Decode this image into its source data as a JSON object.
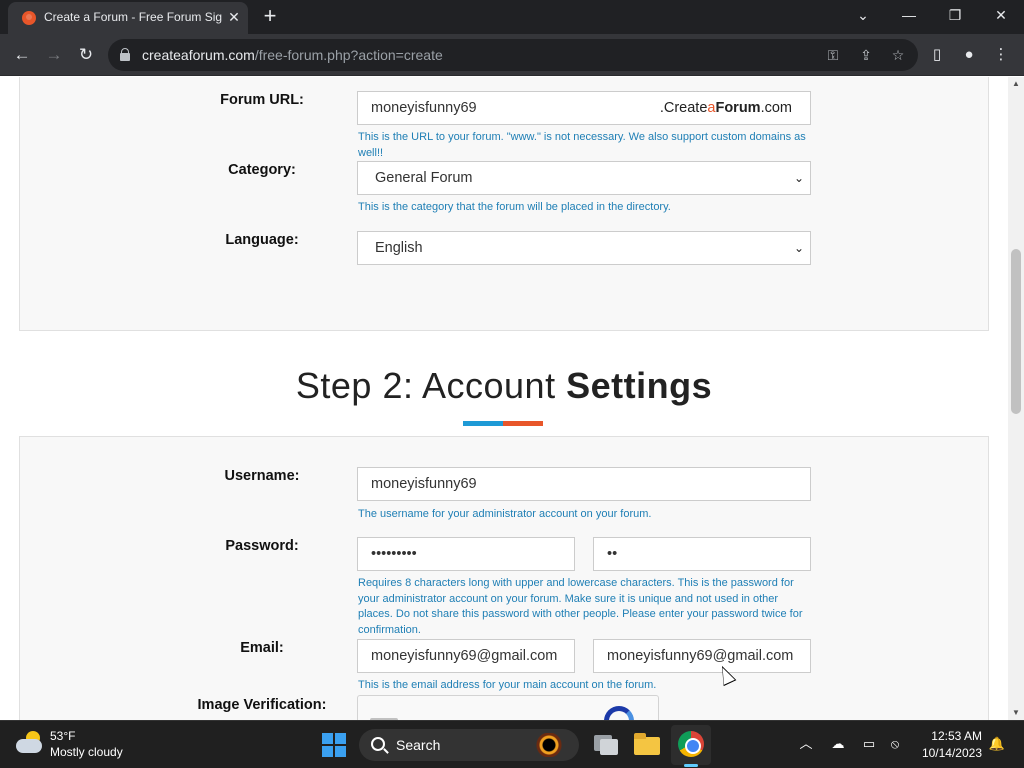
{
  "browser": {
    "tab_title": "Create a Forum - Free Forum Sign",
    "tab_close": "✕",
    "new_tab": "+",
    "url_domain": "createaforum.com",
    "url_path": "/free-forum.php?action=create",
    "window_controls": {
      "minimize": "—",
      "restore": "❐",
      "close": "✕",
      "tab_list": "⌄"
    }
  },
  "form_section1": {
    "forum_url": {
      "label": "Forum URL:",
      "value": "moneyisfunny69",
      "suffix_prefix": ".Create",
      "suffix_a": "a",
      "suffix_bold": "Forum",
      "suffix_end": ".com",
      "help": "This is the URL to your forum. \"www.\" is not necessary. We also support custom domains as well!!"
    },
    "category": {
      "label": "Category:",
      "value": "General Forum",
      "help": "This is the category that the forum will be placed in the directory."
    },
    "language": {
      "label": "Language:",
      "value": "English"
    }
  },
  "step2": {
    "title_light": "Step 2: Account ",
    "title_bold": "Settings"
  },
  "form_section2": {
    "username": {
      "label": "Username:",
      "value": "moneyisfunny69",
      "help": "The username for your administrator account on your forum."
    },
    "password": {
      "label": "Password:",
      "value": "•••••••••",
      "confirm_value": "••",
      "help": "Requires 8 characters long with upper and lowercase characters. This is the password for your administrator account on your forum. Make sure it is unique and not used in other places. Do not share this password with other people. Please enter your password twice for confirmation."
    },
    "email": {
      "label": "Email:",
      "value": "moneyisfunny69@gmail.com",
      "confirm_value": "moneyisfunny69@gmail.com",
      "help": "This is the email address for your main account on the forum."
    },
    "image_verification": {
      "label": "Image Verification:"
    }
  },
  "taskbar": {
    "temperature": "53°F",
    "weather": "Mostly cloudy",
    "search_label": "Search",
    "time": "12:53 AM",
    "date": "10/14/2023"
  }
}
